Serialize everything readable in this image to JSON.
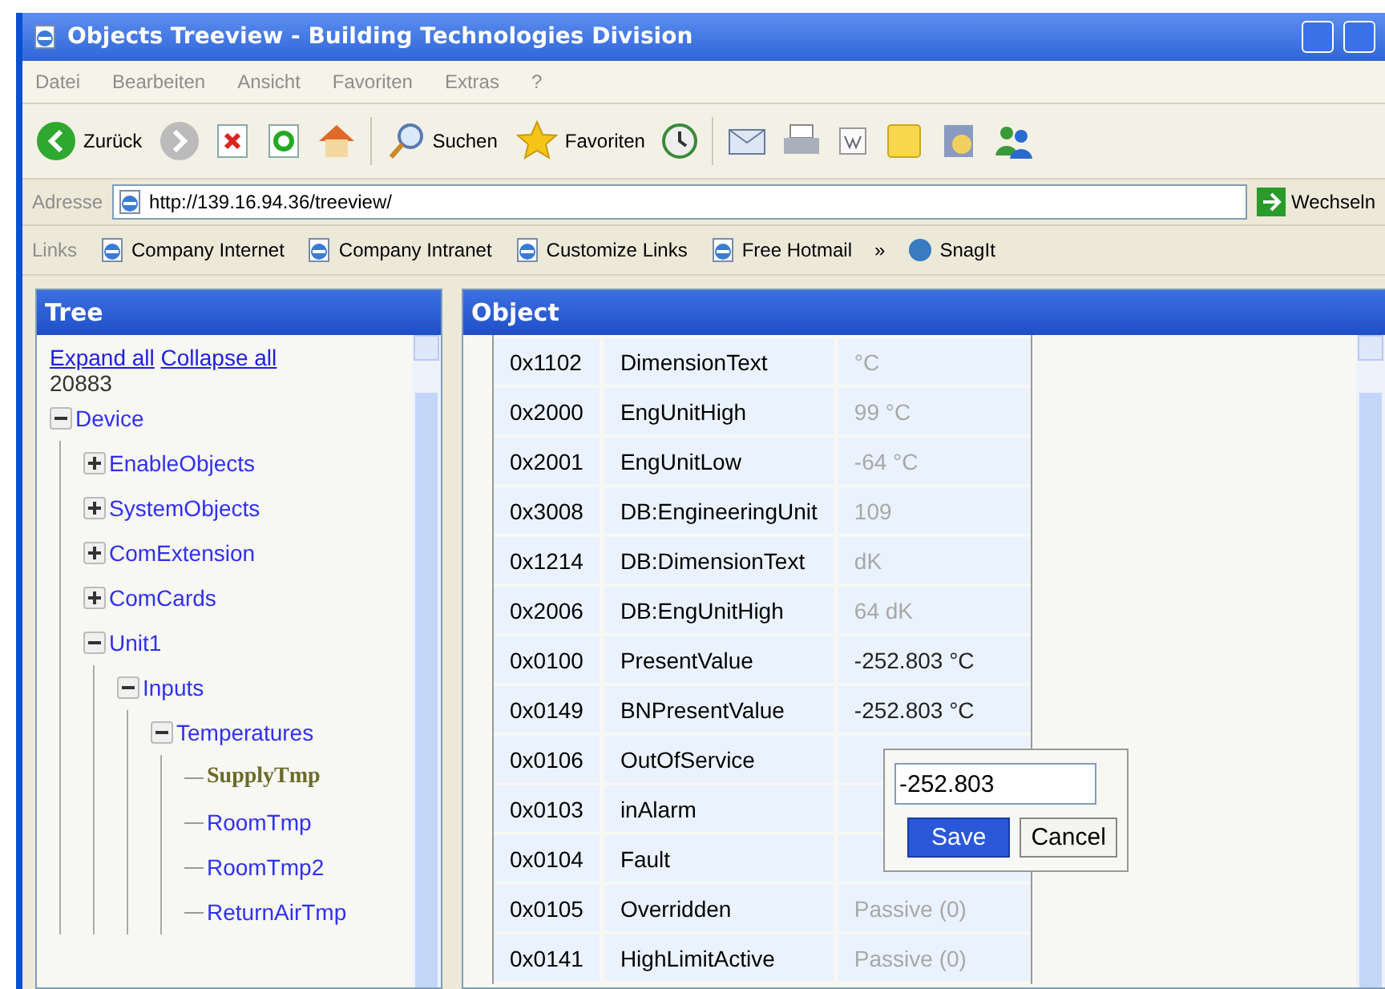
{
  "window": {
    "title": "Objects Treeview - Building Technologies Division"
  },
  "menu": [
    "Datei",
    "Bearbeiten",
    "Ansicht",
    "Favoriten",
    "Extras",
    "?"
  ],
  "toolbar": {
    "back": "Zurück",
    "search": "Suchen",
    "favorites": "Favoriten"
  },
  "address": {
    "label": "Adresse",
    "url": "http://139.16.94.36/treeview/",
    "go": "Wechseln"
  },
  "links": {
    "label": "Links",
    "items": [
      "Company Internet",
      "Company Intranet",
      "Customize Links",
      "Free Hotmail"
    ],
    "chevron": "»",
    "snagit": "SnagIt"
  },
  "tree": {
    "title": "Tree",
    "expand_all": "Expand all",
    "collapse_all": "Collapse all",
    "count": "20883",
    "nodes": [
      {
        "label": "Device",
        "expanded": true,
        "selected": false,
        "children": [
          {
            "label": "EnableObjects",
            "expanded": false,
            "selected": false
          },
          {
            "label": "SystemObjects",
            "expanded": false,
            "selected": false
          },
          {
            "label": "ComExtension",
            "expanded": false,
            "selected": false
          },
          {
            "label": "ComCards",
            "expanded": false,
            "selected": false
          },
          {
            "label": "Unit1",
            "expanded": true,
            "selected": false,
            "children": [
              {
                "label": "Inputs",
                "expanded": true,
                "selected": false,
                "children": [
                  {
                    "label": "Temperatures",
                    "expanded": true,
                    "selected": false,
                    "children": [
                      {
                        "label": "SupplyTmp",
                        "selected": true
                      },
                      {
                        "label": "RoomTmp",
                        "selected": false
                      },
                      {
                        "label": "RoomTmp2",
                        "selected": false
                      },
                      {
                        "label": "ReturnAirTmp",
                        "selected": false
                      }
                    ]
                  }
                ]
              }
            ]
          }
        ]
      }
    ]
  },
  "object": {
    "title": "Object",
    "rows": [
      {
        "id": "0x1102",
        "name": "DimensionText",
        "value": "°C",
        "dimmed": true
      },
      {
        "id": "0x2000",
        "name": "EngUnitHigh",
        "value": "99 °C",
        "dimmed": true
      },
      {
        "id": "0x2001",
        "name": "EngUnitLow",
        "value": "-64 °C",
        "dimmed": true
      },
      {
        "id": "0x3008",
        "name": "DB:EngineeringUnit",
        "value": "109",
        "dimmed": true
      },
      {
        "id": "0x1214",
        "name": "DB:DimensionText",
        "value": "dK",
        "dimmed": true
      },
      {
        "id": "0x2006",
        "name": "DB:EngUnitHigh",
        "value": "64 dK",
        "dimmed": true
      },
      {
        "id": "0x0100",
        "name": "PresentValue",
        "value": "-252.803 °C",
        "dimmed": false
      },
      {
        "id": "0x0149",
        "name": "BNPresentValue",
        "value": "-252.803 °C",
        "dimmed": false
      },
      {
        "id": "0x0106",
        "name": "OutOfService"
      },
      {
        "id": "0x0103",
        "name": "inAlarm"
      },
      {
        "id": "0x0104",
        "name": "Fault"
      },
      {
        "id": "0x0105",
        "name": "Overridden",
        "value": "Passive (0)",
        "dimmed": true
      },
      {
        "id": "0x0141",
        "name": "HighLimitActive",
        "value": "Passive (0)",
        "dimmed": true
      }
    ],
    "editor": {
      "value": "-252.803",
      "save": "Save",
      "cancel": "Cancel"
    }
  }
}
